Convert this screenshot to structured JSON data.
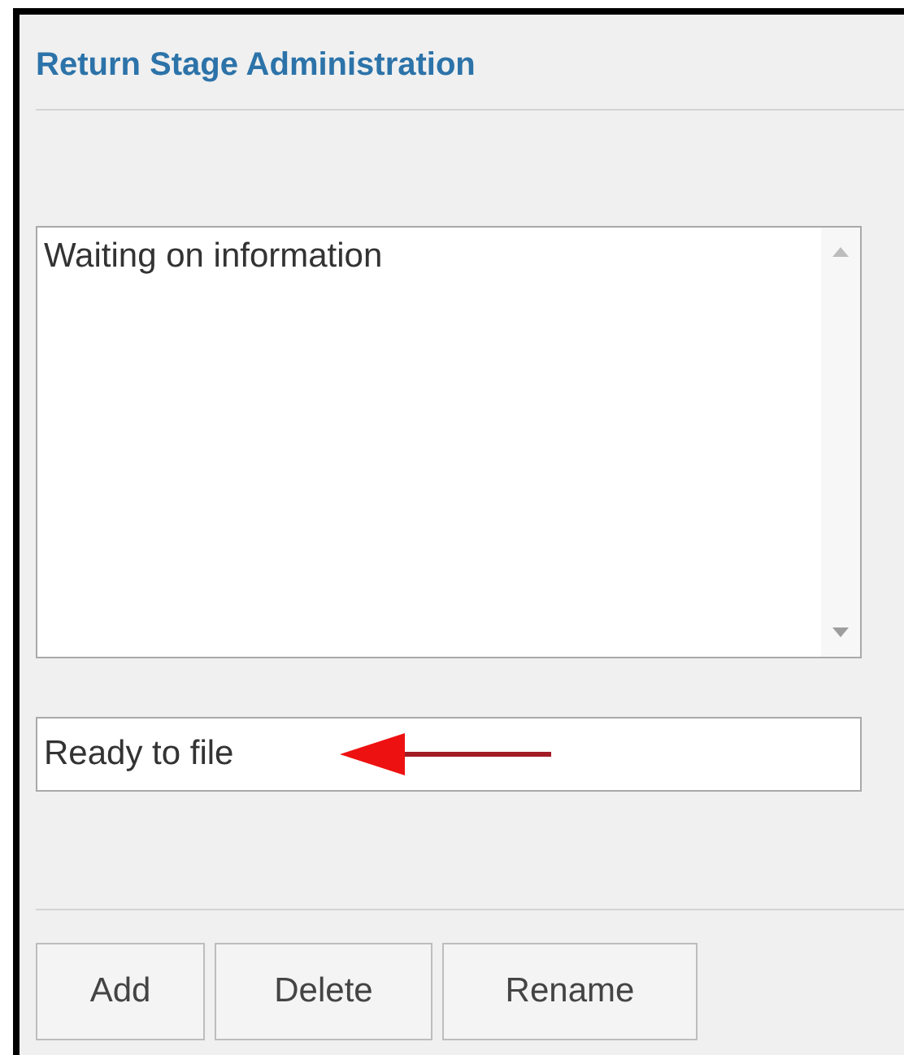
{
  "panel": {
    "title": "Return Stage Administration"
  },
  "stages": [
    {
      "label": "Waiting on information",
      "selected": false
    }
  ],
  "name_field": {
    "value": "Ready to file"
  },
  "buttons": [
    "Add",
    "Delete",
    "Rename"
  ]
}
